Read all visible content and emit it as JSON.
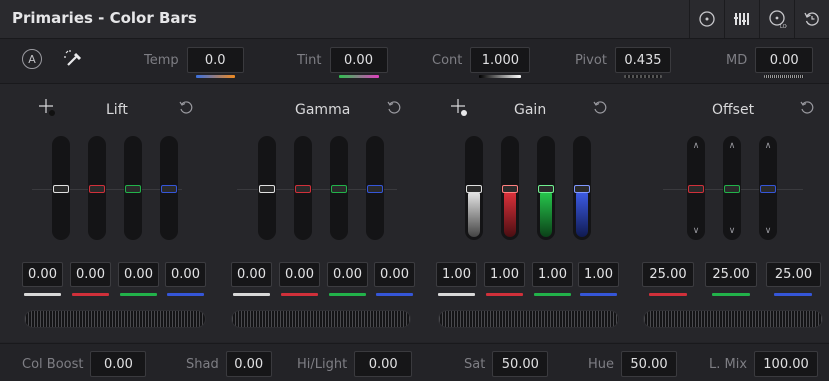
{
  "panel": {
    "title": "Primaries - Color Bars"
  },
  "header_icons": [
    "target-icon",
    "bars-icon",
    "log-icon",
    "reset-all-icon"
  ],
  "toolbar": {
    "auto_label": "A",
    "temp": {
      "label": "Temp",
      "value": "0.0"
    },
    "tint": {
      "label": "Tint",
      "value": "0.00"
    },
    "cont": {
      "label": "Cont",
      "value": "1.000"
    },
    "pivot": {
      "label": "Pivot",
      "value": "0.435"
    },
    "md": {
      "label": "MD",
      "value": "0.00"
    }
  },
  "wheels": {
    "lift": {
      "label": "Lift",
      "values": [
        "0.00",
        "0.00",
        "0.00",
        "0.00"
      ]
    },
    "gamma": {
      "label": "Gamma",
      "values": [
        "0.00",
        "0.00",
        "0.00",
        "0.00"
      ]
    },
    "gain": {
      "label": "Gain",
      "values": [
        "1.00",
        "1.00",
        "1.00",
        "1.00"
      ]
    },
    "offset": {
      "label": "Offset",
      "values": [
        "25.00",
        "25.00",
        "25.00"
      ]
    }
  },
  "colors": {
    "y": "#d8d8d8",
    "r": "#d0303a",
    "g": "#22b24a",
    "b": "#3556d8"
  },
  "bottom": {
    "col_boost": {
      "label": "Col Boost",
      "value": "0.00"
    },
    "shad": {
      "label": "Shad",
      "value": "0.00"
    },
    "hilight": {
      "label": "Hi/Light",
      "value": "0.00"
    },
    "sat": {
      "label": "Sat",
      "value": "50.00"
    },
    "hue": {
      "label": "Hue",
      "value": "50.00"
    },
    "lmix": {
      "label": "L. Mix",
      "value": "100.00"
    }
  }
}
